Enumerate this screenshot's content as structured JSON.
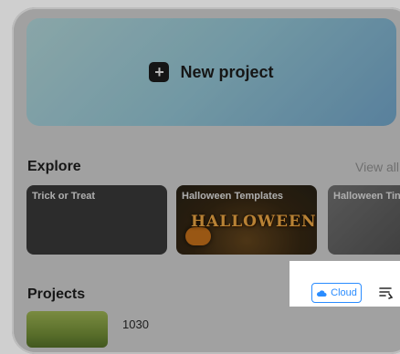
{
  "hero": {
    "label": "New project",
    "icon": "plus-icon"
  },
  "explore": {
    "title": "Explore",
    "view_all": "View all",
    "cards": [
      {
        "label": "Trick or Treat"
      },
      {
        "label": "Halloween Templates",
        "art_text": "HALLOWEEN"
      },
      {
        "label": "Halloween Tin"
      }
    ]
  },
  "projects": {
    "title": "Projects",
    "cloud_label": "Cloud",
    "items": [
      {
        "name": "1030"
      }
    ]
  },
  "colors": {
    "accent": "#2a8cff",
    "hero_gradient_start": "#bfe6e9",
    "hero_gradient_end": "#7bb2d9"
  }
}
